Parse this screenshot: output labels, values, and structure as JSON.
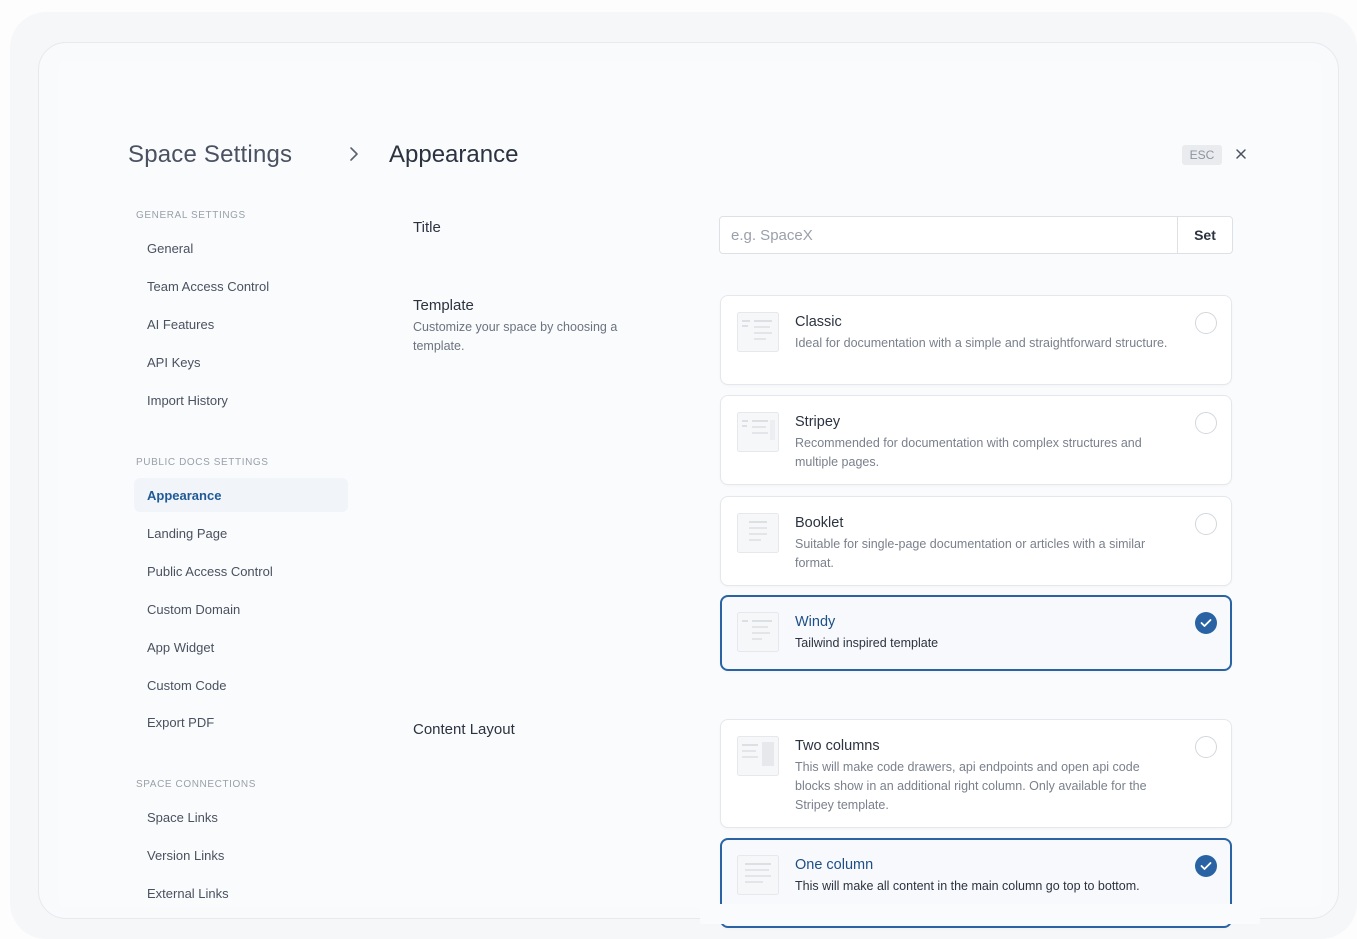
{
  "header": {
    "parent": "Space Settings",
    "current": "Appearance",
    "esc_label": "ESC"
  },
  "sidebar": {
    "sections": [
      {
        "heading": "GENERAL SETTINGS",
        "items": [
          "General",
          "Team Access Control",
          "AI Features",
          "API Keys",
          "Import History"
        ]
      },
      {
        "heading": "PUBLIC DOCS SETTINGS",
        "items": [
          "Appearance",
          "Landing Page",
          "Public Access Control",
          "Custom Domain",
          "App Widget",
          "Custom Code",
          "Export PDF"
        ]
      },
      {
        "heading": "SPACE CONNECTIONS",
        "items": [
          "Space Links",
          "Version Links",
          "External Links"
        ]
      }
    ],
    "active_item": "Appearance"
  },
  "main": {
    "title_label": "Title",
    "title_placeholder": "e.g. SpaceX",
    "title_value": "",
    "set_label": "Set",
    "template_label": "Template",
    "template_desc": "Customize your space by choosing a template.",
    "templates": [
      {
        "title": "Classic",
        "desc": "Ideal for documentation with a simple and straightforward structure.",
        "selected": false
      },
      {
        "title": "Stripey",
        "desc": "Recommended for documentation with complex structures and multiple pages.",
        "selected": false
      },
      {
        "title": "Booklet",
        "desc": "Suitable for single-page documentation or articles with a similar format.",
        "selected": false
      },
      {
        "title": "Windy",
        "desc": "Tailwind inspired template",
        "selected": true
      }
    ],
    "layout_label": "Content Layout",
    "layouts": [
      {
        "title": "Two columns",
        "desc": "This will make code drawers, api endpoints and open api code blocks show in an additional right column. Only available for the Stripey template.",
        "selected": false
      },
      {
        "title": "One column",
        "desc": "This will make all content in the main column go top to bottom.",
        "selected": true
      }
    ]
  },
  "colors": {
    "accent": "#2a63a3",
    "active_nav_text": "#1f5a96"
  },
  "icons": [
    "chevron-right-icon",
    "close-icon",
    "template-thumbnail-icon",
    "check-icon"
  ]
}
